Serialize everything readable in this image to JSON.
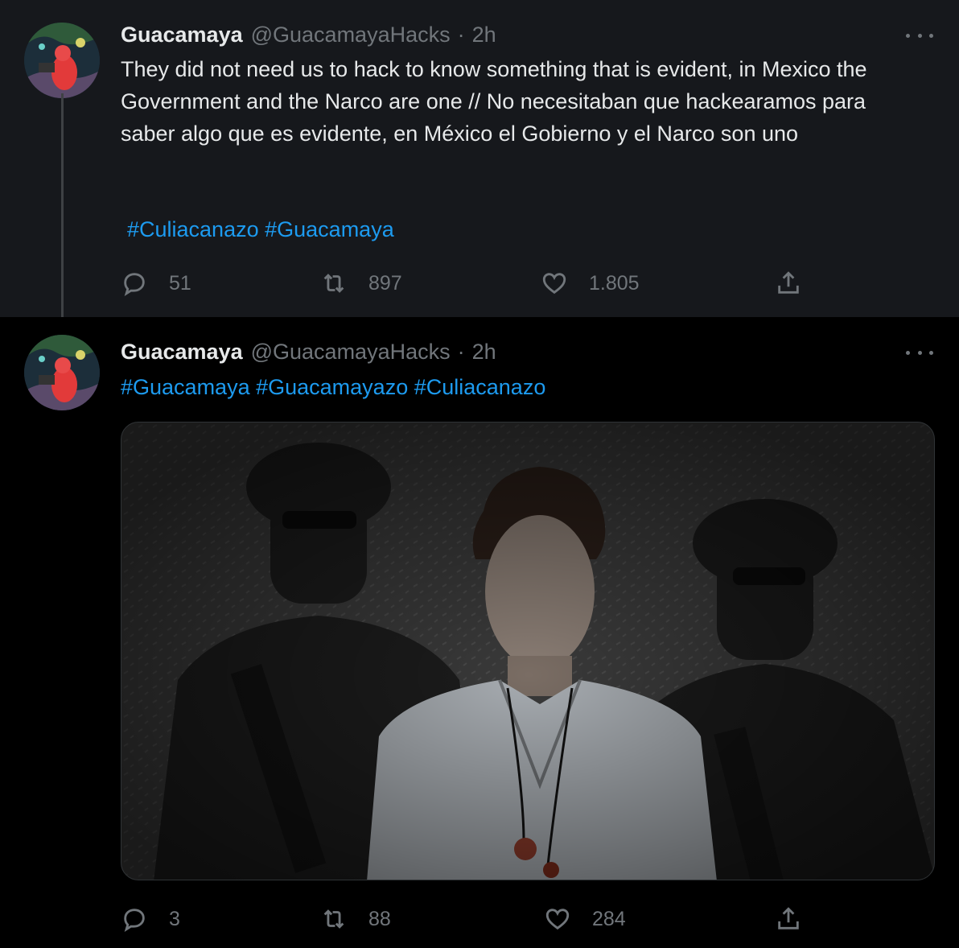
{
  "tweets": [
    {
      "name": "Guacamaya",
      "handle": "@GuacamayaHacks",
      "separator": "·",
      "time": "2h",
      "text": "They did not need us to hack to know something that is evident, in Mexico the Government and the Narco are one // No necesitaban que hackearamos para saber algo que es evidente, en México el Gobierno y el Narco son uno",
      "hashtags": [
        "#Culiacanazo",
        "#Guacamaya"
      ],
      "replies": "51",
      "retweets": "897",
      "likes": "1.805"
    },
    {
      "name": "Guacamaya",
      "handle": "@GuacamayaHacks",
      "separator": "·",
      "time": "2h",
      "hashtags": [
        "#Guacamaya",
        "#Guacamayazo",
        "#Culiacanazo"
      ],
      "replies": "3",
      "retweets": "88",
      "likes": "284"
    }
  ],
  "icons": {
    "reply": "reply-icon",
    "retweet": "retweet-icon",
    "like": "heart-icon",
    "share": "share-icon",
    "more": "more-icon"
  },
  "colors": {
    "link": "#1d9bf0",
    "secondary_text": "#71767b",
    "primary_text": "#e7e9ea",
    "highlighted_tweet_bg": "#16181c",
    "background": "#000000"
  }
}
